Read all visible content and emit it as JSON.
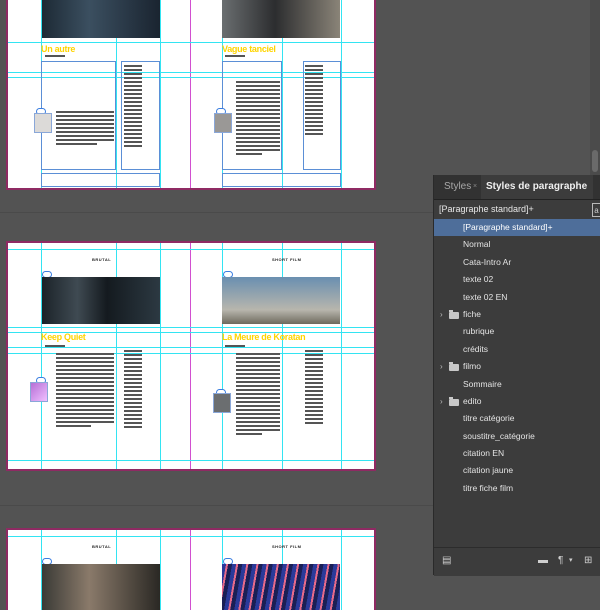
{
  "panel": {
    "tabs": [
      {
        "label": "Styles"
      },
      {
        "label": "Styles de paragraphe"
      }
    ],
    "current_style": "[Paragraphe standard]+",
    "side_icon": "a",
    "styles": [
      {
        "label": "[Paragraphe standard]+",
        "selected": true,
        "group": false
      },
      {
        "label": "Normal",
        "selected": false,
        "group": false
      },
      {
        "label": "Cata-Intro Ar",
        "selected": false,
        "group": false
      },
      {
        "label": "texte 02",
        "selected": false,
        "group": false
      },
      {
        "label": "texte 02 EN",
        "selected": false,
        "group": false
      },
      {
        "label": "fiche",
        "selected": false,
        "group": true
      },
      {
        "label": "rubrique",
        "selected": false,
        "group": false
      },
      {
        "label": "crédits",
        "selected": false,
        "group": false
      },
      {
        "label": "filmo",
        "selected": false,
        "group": true
      },
      {
        "label": "Sommaire",
        "selected": false,
        "group": false
      },
      {
        "label": "edito",
        "selected": false,
        "group": true
      },
      {
        "label": "titre catégorie",
        "selected": false,
        "group": false
      },
      {
        "label": "soustitre_catégorie",
        "selected": false,
        "group": false
      },
      {
        "label": "citation EN",
        "selected": false,
        "group": false
      },
      {
        "label": "citation jaune",
        "selected": false,
        "group": false
      },
      {
        "label": "titre fiche film",
        "selected": false,
        "group": false
      }
    ],
    "footer_icons": [
      "load-styles-icon",
      "new-group-icon",
      "clear-overrides-icon",
      "new-style-icon"
    ]
  },
  "spreads": {
    "s1": {
      "title_left": "Un autre",
      "title_right": "Vague tanciel"
    },
    "s2": {
      "header_left": "BRUTAL",
      "header_right": "SHORT FILM",
      "title_left": "Keep Quiet",
      "title_right": "La Meure de Koratan"
    },
    "s3": {
      "header_left": "BRUTAL",
      "header_right": "SHORT FILM"
    }
  },
  "colors": {
    "workspace": "#535353",
    "panel": "#3c3c3c",
    "selection": "#4e6e9a",
    "guide": "#33e4f2",
    "margin": "#d14fd0",
    "title": "#ffd400"
  }
}
